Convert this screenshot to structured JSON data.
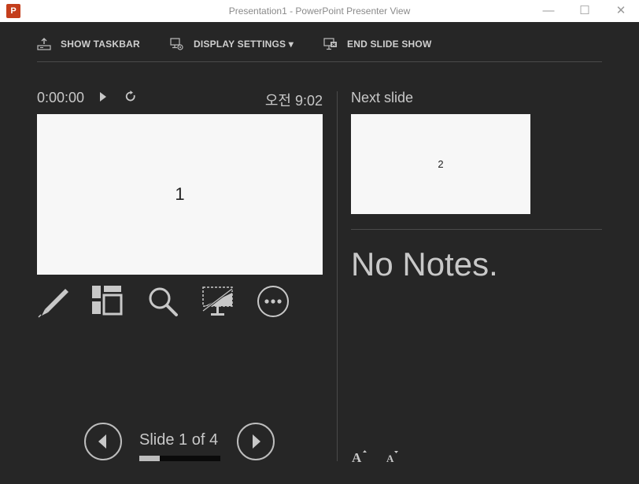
{
  "window": {
    "app_icon_letter": "P",
    "title": "Presentation1 - PowerPoint Presenter View",
    "minimize": "—",
    "maximize": "☐",
    "close": "✕"
  },
  "toolbar": {
    "show_taskbar": "SHOW TASKBAR",
    "display_settings": "DISPLAY SETTINGS ▾",
    "end_slide_show": "END SLIDE SHOW"
  },
  "timer": {
    "elapsed": "0:00:00",
    "clock": "오전 9:02"
  },
  "current_slide": {
    "number": "1"
  },
  "next_slide": {
    "label": "Next slide",
    "number": "2"
  },
  "notes": {
    "text": "No Notes."
  },
  "navigation": {
    "counter": "Slide 1 of 4",
    "progress": 0.25
  },
  "colors": {
    "background": "#262626",
    "powerpoint_red": "#c43e1c"
  },
  "icons": [
    "pen-icon",
    "see-all-slides-icon",
    "zoom-icon",
    "black-screen-icon",
    "more-options-icon",
    "prev-arrow-icon",
    "next-arrow-icon",
    "increase-font-icon",
    "decrease-font-icon"
  ]
}
